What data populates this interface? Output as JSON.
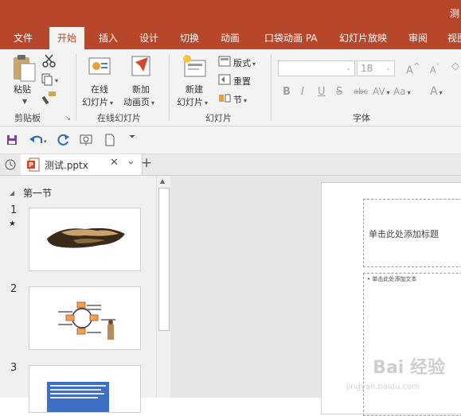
{
  "titlebar": {
    "title": "测"
  },
  "tabs": [
    {
      "label": "文件"
    },
    {
      "label": "开始"
    },
    {
      "label": "插入"
    },
    {
      "label": "设计"
    },
    {
      "label": "切换"
    },
    {
      "label": "动画"
    },
    {
      "label": "口袋动画 PA"
    },
    {
      "label": "幻灯片放映"
    },
    {
      "label": "审阅"
    },
    {
      "label": "视图"
    }
  ],
  "ribbon": {
    "clipboard": {
      "paste": "粘贴",
      "group": "剪贴板"
    },
    "online": {
      "online_line1": "在线",
      "online_line2": "幻灯片",
      "new_line1": "新加",
      "new_line2": "动画页",
      "group": "在线幻灯片"
    },
    "slides": {
      "new_line1": "新建",
      "new_line2": "幻灯片",
      "layout": "版式",
      "reset": "重置",
      "section": "节",
      "group": "幻灯片"
    },
    "font": {
      "size": "18",
      "group": "字体",
      "bold": "B",
      "italic": "I",
      "underline": "U",
      "strike": "S",
      "shadow": "abc",
      "spacing": "AV",
      "case": "Aa",
      "color": "A",
      "grow": "A",
      "shrink": "A"
    }
  },
  "doctab": {
    "name": "测试.pptx"
  },
  "panel": {
    "section": "第一节",
    "slides": [
      {
        "num": "1",
        "star": "★"
      },
      {
        "num": "2"
      },
      {
        "num": "3"
      }
    ]
  },
  "slide": {
    "title_placeholder": "单击此处添加标题",
    "body_placeholder": "• 单击此处添加文本"
  },
  "watermark": {
    "main": "Bai 经验",
    "sub": "jingyan.baidu.com"
  }
}
